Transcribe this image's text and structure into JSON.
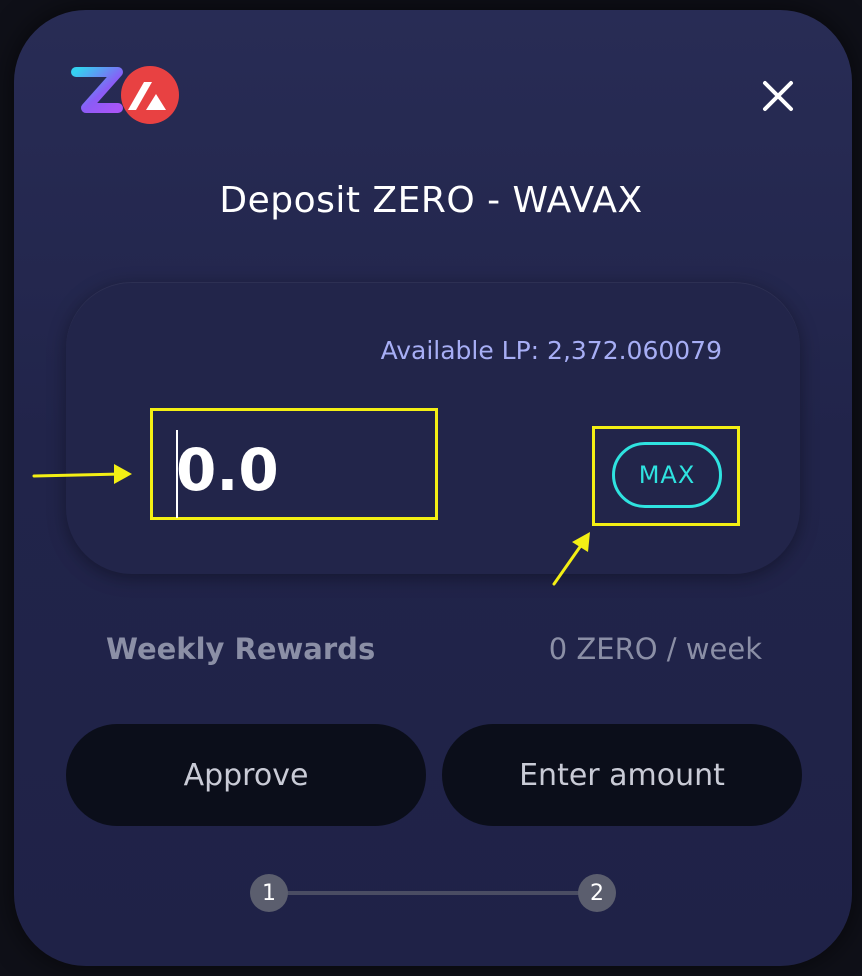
{
  "modal": {
    "title": "Deposit ZERO - WAVAX",
    "available_lp": "Available LP: 2,372.060079",
    "amount_value": "0.0",
    "max_label": "MAX",
    "rewards_label": "Weekly Rewards",
    "rewards_value": "0 ZERO / week",
    "approve_label": "Approve",
    "enter_label": "Enter amount",
    "steps": [
      "1",
      "2"
    ]
  },
  "icons": {
    "logo": "zero-avalanche-logo",
    "close": "close-icon",
    "annotation_arrows": [
      "arrow-right-icon",
      "arrow-up-right-icon"
    ]
  },
  "colors": {
    "accent_max": "#2fe3e0",
    "highlight": "#f3ef14",
    "available_text": "#a7aef5",
    "avalanche_red": "#e84142"
  }
}
